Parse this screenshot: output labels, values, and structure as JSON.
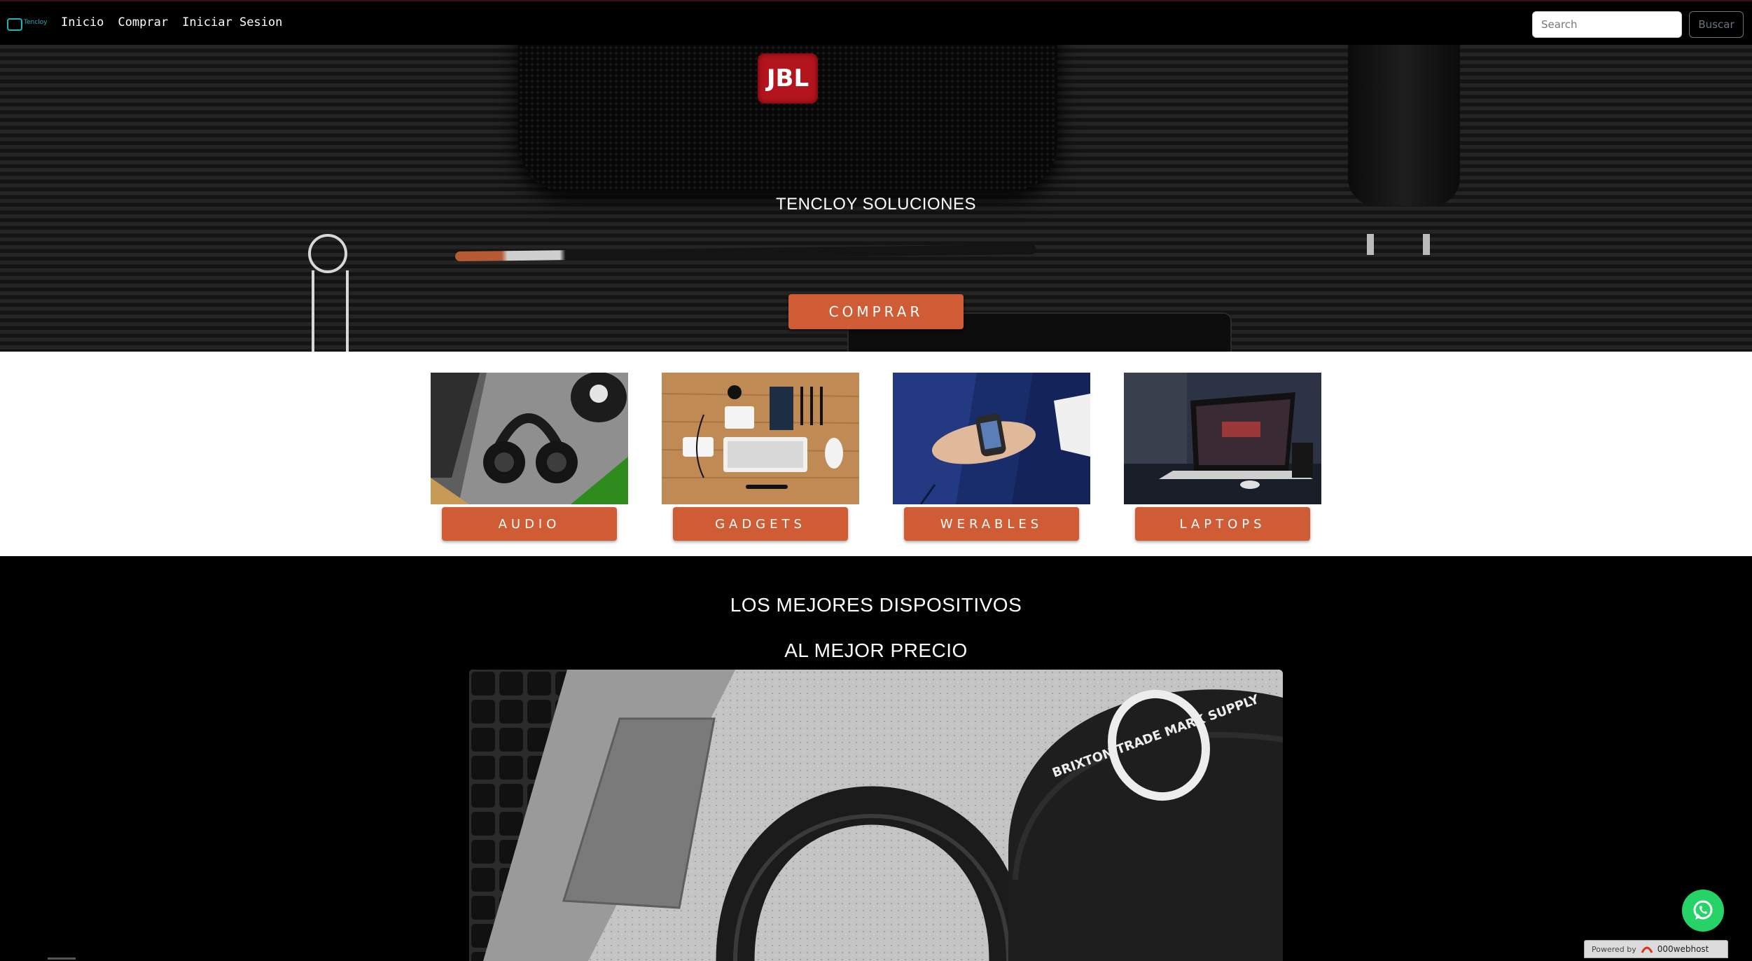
{
  "navbar": {
    "brand_text": "Tencloy",
    "links": [
      "Inicio",
      "Comprar",
      "Iniciar Sesion"
    ],
    "search": {
      "placeholder": "Search",
      "button_label": "Buscar"
    }
  },
  "hero": {
    "speaker_logo": "JBL",
    "title": "TENCLOY SOLUCIONES",
    "button_label": "COMPRAR"
  },
  "categories": [
    {
      "label": "AUDIO",
      "icon": "headphones-photo"
    },
    {
      "label": "GADGETS",
      "icon": "desk-gadgets-photo"
    },
    {
      "label": "WERABLES",
      "icon": "smartwatch-photo"
    },
    {
      "label": "LAPTOPS",
      "icon": "laptop-photo"
    }
  ],
  "promo": {
    "line1": "LOS MEJORES DISPOSITIVOS",
    "line2": "AL MEJOR PRECIO",
    "cap_text": "BRIXTON TRADE MARK SUPPLY"
  },
  "footer": {
    "powered_text": "Powered by",
    "host_name": "000webhost"
  },
  "colors": {
    "accent": "#cf5c35",
    "navbar_bg": "#000000",
    "whatsapp": "#25d366"
  }
}
